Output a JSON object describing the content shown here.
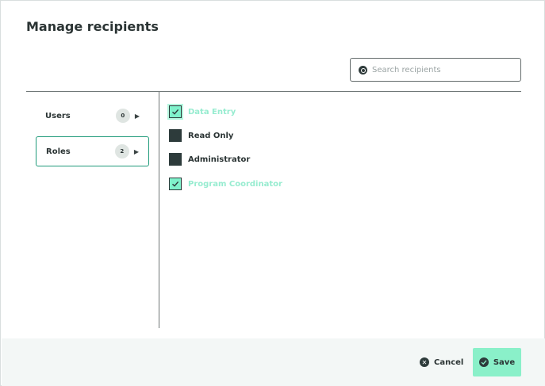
{
  "dialog": {
    "title": "Manage recipients"
  },
  "search": {
    "placeholder": "Search recipients",
    "value": ""
  },
  "nav": {
    "items": [
      {
        "label": "Users",
        "count": "0",
        "active": false
      },
      {
        "label": "Roles",
        "count": "2",
        "active": true
      }
    ]
  },
  "roles": [
    {
      "label": "Data Entry",
      "checked": true
    },
    {
      "label": "Read Only",
      "checked": false
    },
    {
      "label": "Administrator",
      "checked": false
    },
    {
      "label": "Program Coordinator",
      "checked": true
    }
  ],
  "footer": {
    "cancel_label": "Cancel",
    "save_label": "Save"
  },
  "colors": {
    "accent": "#8af0c9",
    "accent_border": "#1f9a7a",
    "checked_label": "#97ecd0",
    "dark": "#2d3b3b"
  },
  "icons": {
    "search": "search-icon",
    "arrow": "triangle-right-icon",
    "check": "check-icon",
    "cancel": "close-circle-icon",
    "save": "check-circle-icon"
  }
}
